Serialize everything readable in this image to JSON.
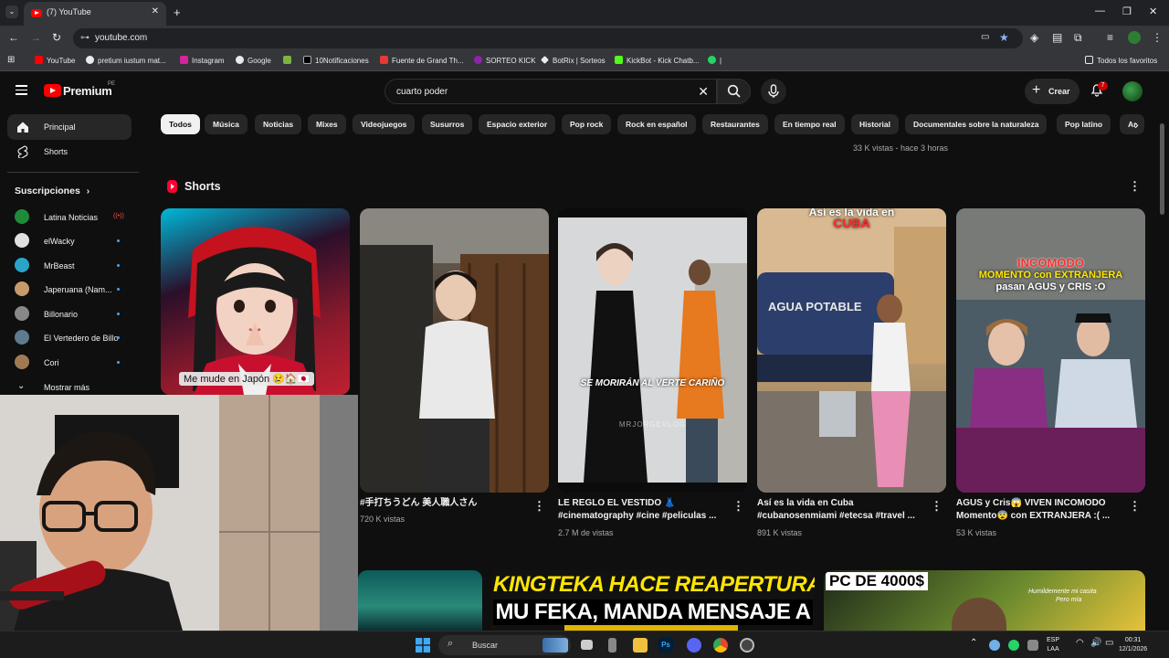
{
  "browser": {
    "tab_title": "(7) YouTube",
    "url": "youtube.com",
    "bookmarks": [
      "YouTube",
      "pretium iustum mat...",
      "Instagram",
      "Google",
      "10Notificaciones",
      "Fuente de Grand Th...",
      "SORTEO KICK",
      "BotRix | Sorteos",
      "KickBot - Kick Chatb...",
      "|"
    ],
    "all_bookmarks": "Todos los favoritos"
  },
  "header": {
    "logo_text": "Premium",
    "region": "PE",
    "search_query": "cuarto poder",
    "create_label": "Crear",
    "notifications_count": "7"
  },
  "sidebar": {
    "items": [
      {
        "label": "Principal",
        "icon": "home-icon"
      },
      {
        "label": "Shorts",
        "icon": "shorts-icon"
      }
    ],
    "subscriptions_title": "Suscripciones",
    "subscriptions": [
      {
        "name": "Latina Noticias",
        "color": "#1f8b3a",
        "live": true
      },
      {
        "name": "elWacky",
        "color": "#d9d9d9",
        "live": false
      },
      {
        "name": "MrBeast",
        "color": "#2aa3c9",
        "live": false
      },
      {
        "name": "Japeruana (Nam...",
        "color": "#c69a6b",
        "live": false
      },
      {
        "name": "Billonario",
        "color": "#888888",
        "live": false
      },
      {
        "name": "El Vertedero de Billo",
        "color": "#5d7a8e",
        "live": false
      },
      {
        "name": "Cori",
        "color": "#a07a52",
        "live": false
      }
    ],
    "show_more": "Mostrar más"
  },
  "chips": [
    "Todos",
    "Música",
    "Noticias",
    "Mixes",
    "Videojuegos",
    "Susurros",
    "Espacio exterior",
    "Pop rock",
    "Rock en español",
    "Restaurantes",
    "En tiempo real",
    "Historial",
    "Documentales sobre la naturaleza",
    "Pop latino",
    "Ar"
  ],
  "prev_video_meta": "33 K vistas - hace 3 horas",
  "shorts": {
    "section_title": "Shorts",
    "items": [
      {
        "title": "",
        "views": "",
        "overlay": "Me mude en Japón 😢🏠🇯🇵"
      },
      {
        "title": "#手打ちうどん 美人職人さん",
        "views": "720 K vistas",
        "overlay": ""
      },
      {
        "title": "LE REGLO EL VESTIDO 👗 #cinematography #cine #peliculas ...",
        "views": "2.7 M de vistas",
        "overlay": "SE MORIRÁN AL VERTE CARIÑO",
        "watermark": "MRJORGEVLOG"
      },
      {
        "title": "Así es la vida en Cuba #cubanosenmiami #etecsa #travel ...",
        "views": "891 K vistas",
        "overlay_top": "Así es la vida en",
        "overlay_cuba": "CUBA",
        "tank_text": "AGUA POTABLE"
      },
      {
        "title": "AGUS y Cris😱 VIVEN INCOMODO Momento😨 con EXTRANJERA :( ...",
        "views": "53 K vistas",
        "overlay_1": "INCOMODO",
        "overlay_2": "MOMENTO con EXTRANJERA",
        "overlay_3": "pasan AGUS y CRIS :O"
      }
    ]
  },
  "videos": [
    {
      "thumb_text_1": "KINGTEKA HACE REAPERTURA DEL",
      "thumb_text_2": "MU FEKA, MANDA MENSAJE A"
    },
    {
      "thumb_text_1": "PC DE 4000$",
      "thumb_text_2": "Humildemente mi casita",
      "thumb_text_3": "Pero mía"
    }
  ],
  "taskbar": {
    "search_label": "Buscar",
    "lang_1": "ESP",
    "lang_2": "LAA",
    "time": "00:31",
    "date": "12/1/2026"
  }
}
